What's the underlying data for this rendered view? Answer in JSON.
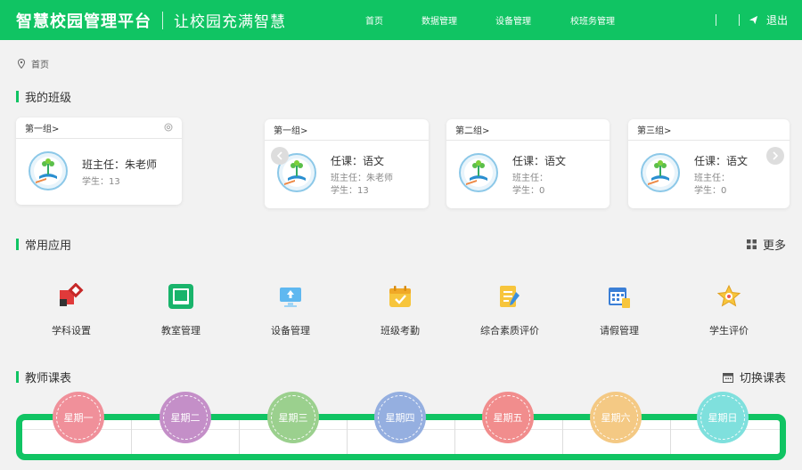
{
  "header": {
    "title": "智慧校园管理平台",
    "slogan": "让校园充满智慧",
    "nav": [
      "首页",
      "数据管理",
      "设备管理",
      "校班务管理"
    ],
    "logout": "退出",
    "accent": "#10c463"
  },
  "breadcrumb": {
    "home": "首页"
  },
  "my_class": {
    "title": "我的班级",
    "cards": [
      {
        "group": "第一组>",
        "main": "班主任：朱老师",
        "lines": [
          "学生：13"
        ]
      },
      {
        "group": "第一组>",
        "main": "任课：语文",
        "lines": [
          "班主任：朱老师",
          "学生：13"
        ]
      },
      {
        "group": "第二组>",
        "main": "任课：语文",
        "lines": [
          "班主任：",
          "学生：0"
        ]
      },
      {
        "group": "第三组>",
        "main": "任课：语文",
        "lines": [
          "班主任：",
          "学生：0"
        ]
      }
    ]
  },
  "apps": {
    "title": "常用应用",
    "more": "更多",
    "items": [
      {
        "label": "学科设置",
        "icon": "subject-settings-icon"
      },
      {
        "label": "教室管理",
        "icon": "classroom-icon"
      },
      {
        "label": "设备管理",
        "icon": "device-icon"
      },
      {
        "label": "班级考勤",
        "icon": "attendance-icon"
      },
      {
        "label": "综合素质评价",
        "icon": "quality-evaluation-icon"
      },
      {
        "label": "请假管理",
        "icon": "leave-calendar-icon"
      },
      {
        "label": "学生评价",
        "icon": "student-evaluation-icon"
      }
    ]
  },
  "timetable": {
    "title": "教师课表",
    "switch": "切换课表",
    "days": [
      {
        "label": "星期一",
        "color": "#f0909a"
      },
      {
        "label": "星期二",
        "color": "#c48fc8"
      },
      {
        "label": "星期三",
        "color": "#9bd08e"
      },
      {
        "label": "星期四",
        "color": "#95afe0"
      },
      {
        "label": "星期五",
        "color": "#f18d8d"
      },
      {
        "label": "星期六",
        "color": "#f4c984"
      },
      {
        "label": "星期日",
        "color": "#7fe0dd"
      }
    ]
  }
}
